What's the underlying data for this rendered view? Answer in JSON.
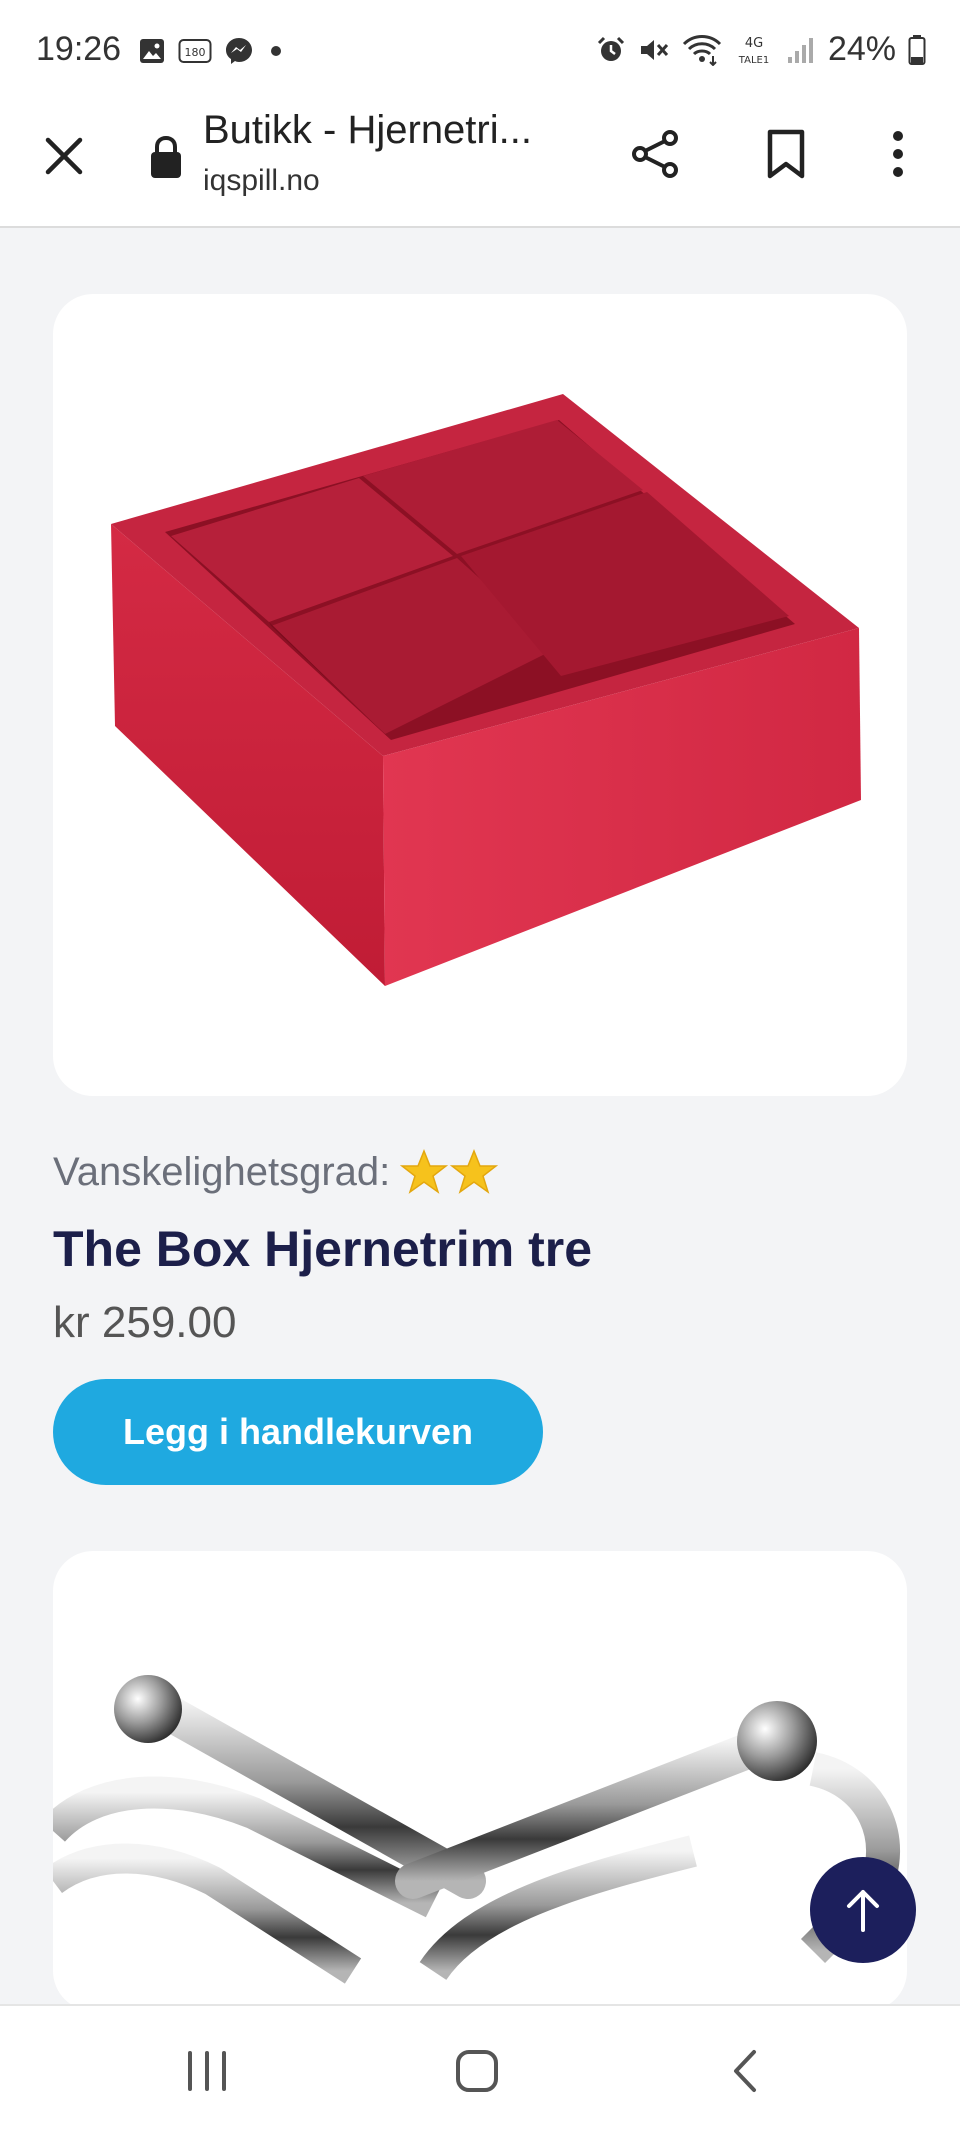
{
  "status_bar": {
    "time": "19:26",
    "badge_number": "180",
    "network": "4G",
    "network_sub": "TALE1",
    "battery": "24%",
    "icons": [
      "image-icon",
      "badge-180-icon",
      "messenger-icon",
      "dot-icon",
      "alarm-icon",
      "mute-icon",
      "wifi-icon",
      "signal-icon",
      "battery-icon"
    ]
  },
  "browser": {
    "page_title": "Butikk - Hjernetri...",
    "url": "iqspill.no",
    "icons": [
      "close-icon",
      "lock-icon",
      "share-icon",
      "bookmark-icon",
      "more-vert-icon"
    ]
  },
  "products": [
    {
      "difficulty_label": "Vanskelighetsgrad:",
      "difficulty_stars": 2,
      "title": "The Box Hjernetrim tre",
      "price": "kr 259.00",
      "add_to_cart_label": "Legg i handlekurven",
      "image": "red-wooden-box-puzzle"
    },
    {
      "image": "metal-wire-puzzle"
    }
  ],
  "colors": {
    "accent_button": "#1fa9e0",
    "title_navy": "#1c1f4a",
    "fab_navy": "#1c1f5c",
    "page_bg": "#f3f4f6",
    "star": "#f6c21c"
  },
  "fab": {
    "icon": "arrow-up-icon"
  },
  "navbar": {
    "icons": [
      "recents-icon",
      "home-icon",
      "back-icon"
    ]
  }
}
